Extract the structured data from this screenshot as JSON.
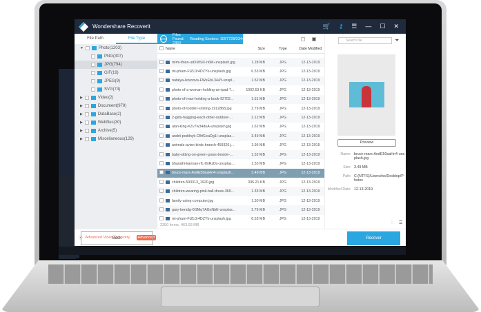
{
  "app": {
    "title": "Wondershare Recoverit"
  },
  "tabs": [
    "File Path",
    "File Type"
  ],
  "tree": [
    {
      "label": "Photo(1203)",
      "level": 0
    },
    {
      "label": "PNG(307)",
      "level": 1
    },
    {
      "label": "JPG(794)",
      "level": 1
    },
    {
      "label": "GIF(19)",
      "level": 1
    },
    {
      "label": "JPEG(9)",
      "level": 1
    },
    {
      "label": "SVG(74)",
      "level": 1
    },
    {
      "label": "Video(2)",
      "level": 0
    },
    {
      "label": "Document(979)",
      "level": 0
    },
    {
      "label": "DataBase(2)",
      "level": 0
    },
    {
      "label": "Webfiles(30)",
      "level": 0
    },
    {
      "label": "Archive(5)",
      "level": 0
    },
    {
      "label": "Miscellaneous(129)",
      "level": 0
    }
  ],
  "advanced": {
    "label": "Advanced Video Recovery",
    "badge": "Advanced"
  },
  "progress": {
    "percent": "50%",
    "files_found": "Files Found: 2350",
    "reading": "Reading Sectors: 1097728/2344366088"
  },
  "columns": [
    "Name",
    "Size",
    "Type",
    "Date Modified"
  ],
  "rows": [
    [
      "mimi-thian-udXMSiX-n6M-unsplash.jpg",
      "1.28 MB",
      "JPG",
      "12-13-2019"
    ],
    [
      "mi-pham-FtZL0r4DZYk-unsplash.jpg",
      "6.53 MB",
      "JPG",
      "12-13-2019"
    ],
    [
      "natalya-letunova-FWxEbL344Y-unspl...",
      "1.52 MB",
      "JPG",
      "12-13-2019"
    ],
    [
      "photo-of-a-woman-holding-an-ipad-7...",
      "1002.53 KB",
      "JPG",
      "12-13-2019"
    ],
    [
      "photo-of-man-holding-a-book-92702...",
      "1.51 MB",
      "JPG",
      "12-13-2019"
    ],
    [
      "photo-of-toddler-smiling-1912868.jpg",
      "2.79 MB",
      "JPG",
      "12-13-2019"
    ],
    [
      "2-girls-hugging-each-other-outdoor-...",
      "2.12 MB",
      "JPG",
      "12-13-2019"
    ],
    [
      "alan-king-KZv7w34duA-unsplash.jpg",
      "1.62 MB",
      "JPG",
      "12-13-2019"
    ],
    [
      "andrii-podilnyk-CfhfEeaDg1I-unsplas...",
      "3.49 MB",
      "JPG",
      "12-13-2019"
    ],
    [
      "animals-avian-birds-branch-459326.j...",
      "1.95 MB",
      "JPG",
      "12-13-2019"
    ],
    [
      "baby-sitting-on-green-grass-beside-...",
      "1.52 MB",
      "JPG",
      "12-13-2019"
    ],
    [
      "bharathi-kannan-rfL-thiRzDs-unsplas...",
      "1.55 MB",
      "JPG",
      "12-13-2019"
    ],
    [
      "bruce-mars-AndE50aaHn4-unsplash...",
      "3.49 MB",
      "JPG",
      "12-13-2019"
    ],
    [
      "children-593313_1920.jpg",
      "336.21 KB",
      "JPG",
      "12-13-2019"
    ],
    [
      "children-wearing-pink-ball-dress-360...",
      "1.33 MB",
      "JPG",
      "12-13-2019"
    ],
    [
      "family-using-computer.jpg",
      "1.50 MB",
      "JPG",
      "12-13-2019"
    ],
    [
      "gary-bendig-6GMq7AGxNbE-unsplas...",
      "2.76 MB",
      "JPG",
      "12-13-2019"
    ],
    [
      "mi-pham-FtZL0r4DZYk-unsplash.jpg",
      "6.53 MB",
      "JPG",
      "12-13-2019"
    ]
  ],
  "selected_row": 12,
  "status": "2350 items, 463.93 MB",
  "search": {
    "placeholder": "Search file"
  },
  "preview": {
    "button": "Preview",
    "name_label": "Name:",
    "name": "bruce-mars-AndE50aaHn4-unsplash.jpg",
    "size_label": "Size:",
    "size": "3.49 MB",
    "path_label": "Path:",
    "path": "C:(NTFS)/Users/ws/Desktop/Photos",
    "date_label": "Modified Date:",
    "date": "12-13-2019"
  },
  "buttons": {
    "back": "Back",
    "recover": "Recover"
  },
  "colors": {
    "accent": "#2aa7e0",
    "titlebar": "#1f2a3d",
    "advanced": "#f36b4f"
  }
}
